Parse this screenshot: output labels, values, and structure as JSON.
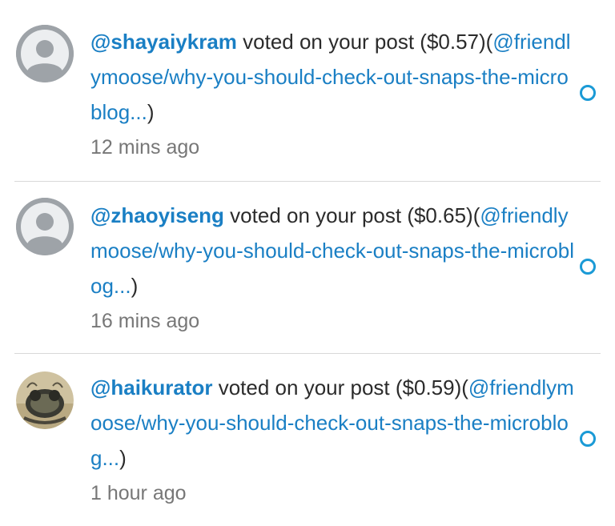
{
  "notifications": [
    {
      "username": "@shayaiykram",
      "action": " voted on your post ($0.57)(",
      "link": "@friendlymoose/why-you-should-check-out-snaps-the-microblog...",
      "close": ")",
      "time": "12 mins ago",
      "avatar": "default-avatar-icon"
    },
    {
      "username": "@zhaoyiseng",
      "action": " voted on your post ($0.65)(",
      "link": "@friendlymoose/why-you-should-check-out-snaps-the-microblog...",
      "close": ")",
      "time": "16 mins ago",
      "avatar": "default-avatar-icon"
    },
    {
      "username": "@haikurator",
      "action": " voted on your post ($0.59)(",
      "link": "@friendlymoose/why-you-should-check-out-snaps-the-microblog...",
      "close": ")",
      "time": "1 hour ago",
      "avatar": "photo-avatar"
    }
  ],
  "colors": {
    "link": "#1a7fc4",
    "unread_dot": "#1a9ad6",
    "divider": "#d9d9d9"
  }
}
